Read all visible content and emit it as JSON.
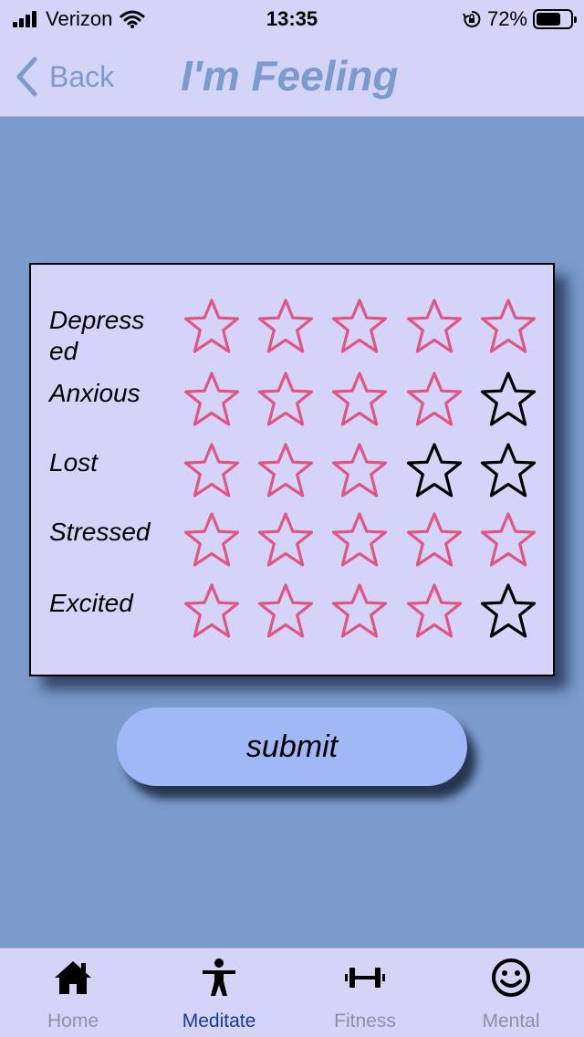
{
  "status_bar": {
    "carrier": "Verizon",
    "time": "13:35",
    "battery": "72%",
    "battery_level": 0.72
  },
  "nav": {
    "back_label": "Back",
    "title": "I'm Feeling"
  },
  "colors": {
    "background": "#7b9bcc",
    "panel": "#d4d4f8",
    "star_filled": "#e05585",
    "star_empty": "#000000",
    "button": "#a0b8f5",
    "tab_active": "#1a3a8c",
    "tab_inactive": "#8f8fa8"
  },
  "ratings": {
    "max": 5,
    "rows": [
      {
        "label": "Depressed",
        "label_display": [
          "Depress",
          "ed"
        ],
        "value": 5
      },
      {
        "label": "Anxious",
        "label_display": [
          "Anxious"
        ],
        "value": 4
      },
      {
        "label": "Lost",
        "label_display": [
          "Lost"
        ],
        "value": 3
      },
      {
        "label": "Stressed",
        "label_display": [
          "Stressed"
        ],
        "value": 5
      },
      {
        "label": "Excited",
        "label_display": [
          "Excited"
        ],
        "value": 4
      }
    ]
  },
  "submit_label": "submit",
  "tabs": [
    {
      "label": "Home",
      "icon": "home-icon",
      "active": false
    },
    {
      "label": "Meditate",
      "icon": "person-icon",
      "active": true
    },
    {
      "label": "Fitness",
      "icon": "dumbbell-icon",
      "active": false
    },
    {
      "label": "Mental",
      "icon": "smiley-icon",
      "active": false
    }
  ]
}
